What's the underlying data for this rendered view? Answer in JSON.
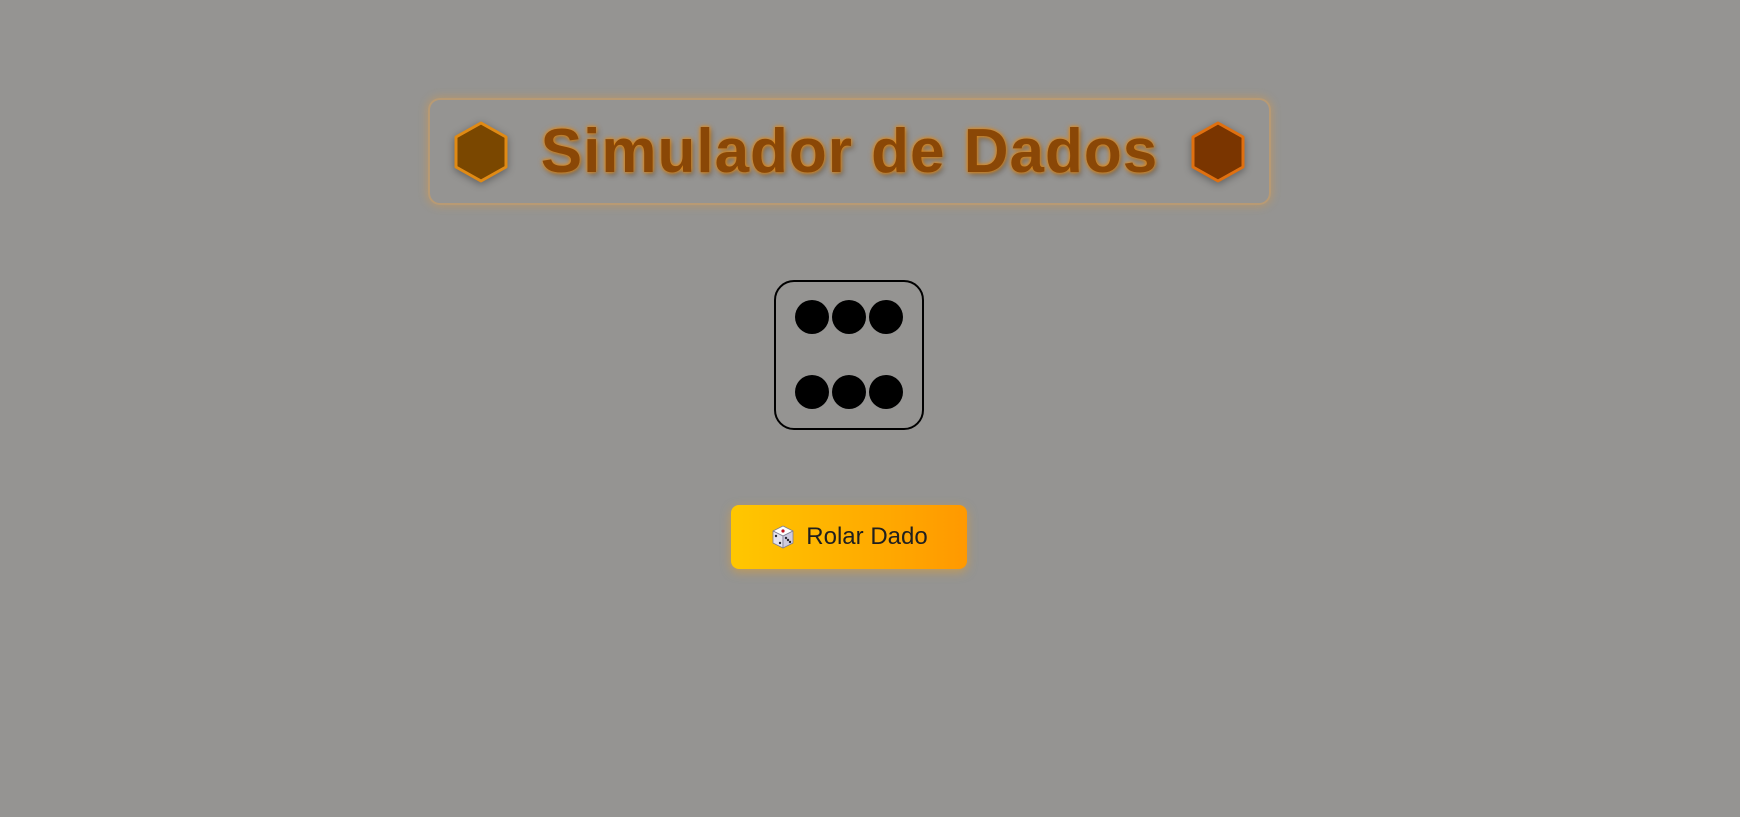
{
  "header": {
    "title": "Simulador de Dados",
    "left_icon": "hexagon-icon",
    "right_icon": "hexagon-icon",
    "left_icon_color": "#7a4700",
    "right_icon_color": "#7a3500",
    "accent_color": "#e58a10"
  },
  "die": {
    "value": 6,
    "pip_color": "#000000",
    "border_color": "#000000"
  },
  "roll_button": {
    "icon": "dice-icon",
    "label": "Rolar Dado",
    "gradient_start": "#ffc700",
    "gradient_end": "#ff9900"
  },
  "background_color": "#959492"
}
